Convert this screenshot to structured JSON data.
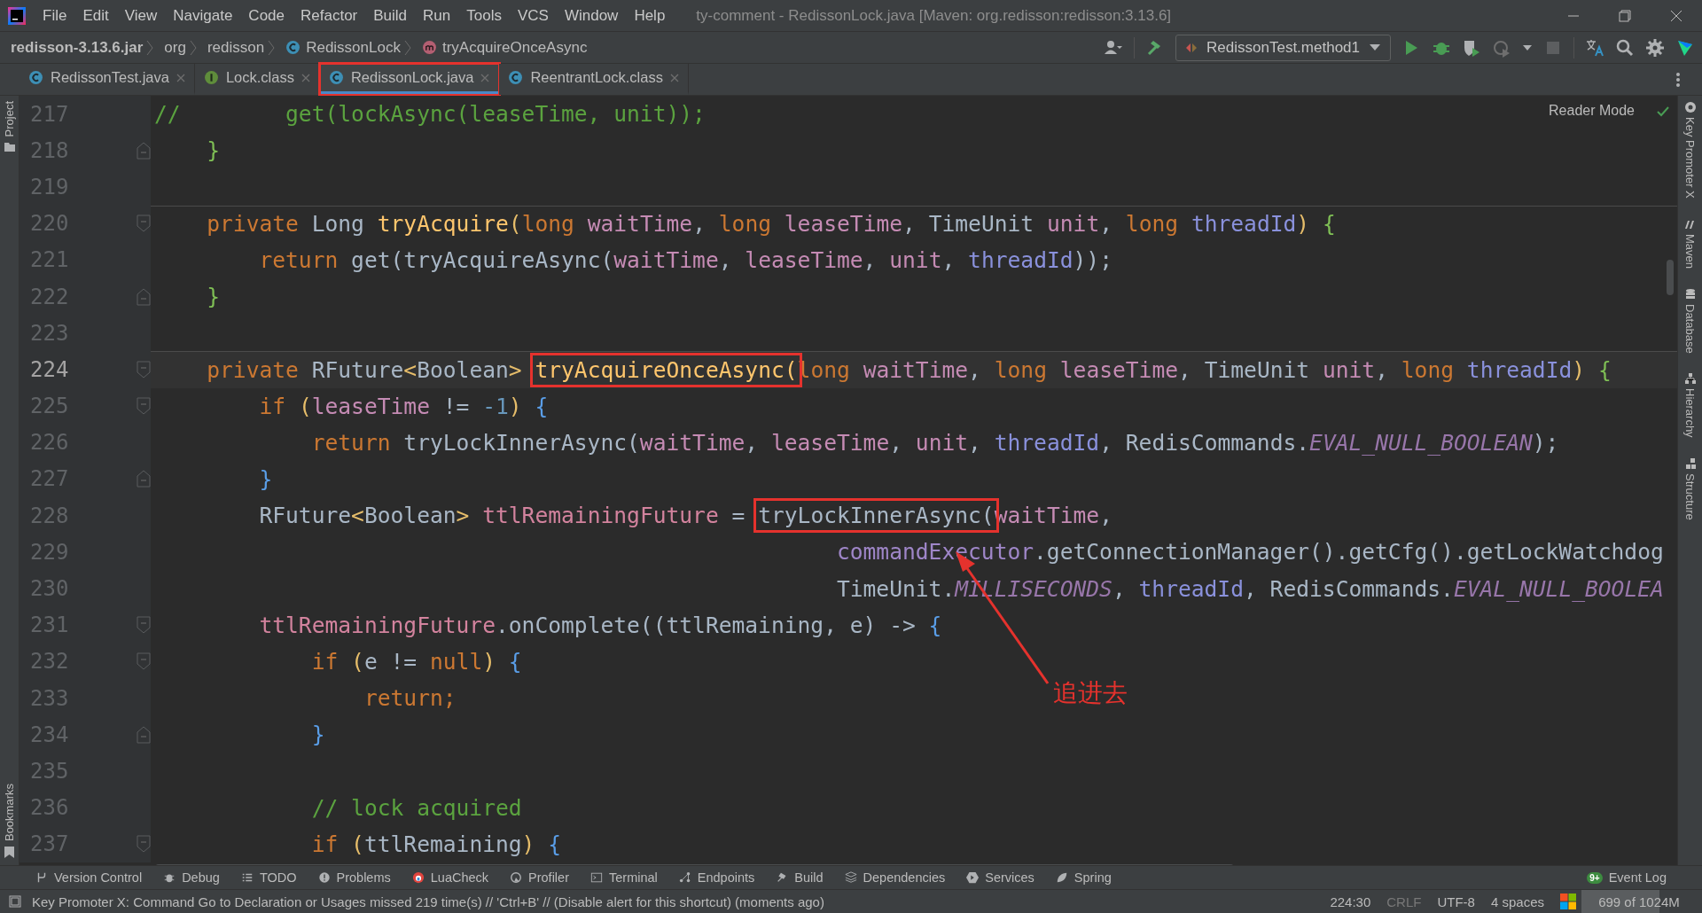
{
  "window": {
    "title": "ty-comment - RedissonLock.java [Maven: org.redisson:redisson:3.13.6]"
  },
  "menu": [
    "File",
    "Edit",
    "View",
    "Navigate",
    "Code",
    "Refactor",
    "Build",
    "Run",
    "Tools",
    "VCS",
    "Window",
    "Help"
  ],
  "breadcrumbs": [
    {
      "text": "redisson-3.13.6.jar",
      "kind": "jar"
    },
    {
      "text": "org",
      "kind": "package"
    },
    {
      "text": "redisson",
      "kind": "package"
    },
    {
      "text": "RedissonLock",
      "kind": "class"
    },
    {
      "text": "tryAcquireOnceAsync",
      "kind": "method"
    }
  ],
  "run_config": "RedissonTest.method1",
  "tabs": [
    {
      "label": "RedissonTest.java",
      "kind": "class",
      "selected": false,
      "highlighted": false
    },
    {
      "label": "Lock.class",
      "kind": "interface",
      "selected": false,
      "highlighted": false
    },
    {
      "label": "RedissonLock.java",
      "kind": "class",
      "selected": true,
      "highlighted": true
    },
    {
      "label": "ReentrantLock.class",
      "kind": "class",
      "selected": false,
      "highlighted": false
    }
  ],
  "reader_mode": "Reader Mode",
  "left_stripe": [
    "Project",
    "Bookmarks"
  ],
  "right_stripe": [
    "Key Promoter X",
    "Maven",
    "Database",
    "Hierarchy",
    "Structure"
  ],
  "lines": [
    {
      "number": "217",
      "current": false,
      "separator": false,
      "fold_open": false,
      "fold_close": false,
      "tokens": [
        {
          "text": "//        get(lockAsync(leaseTime, unit));",
          "kind": "comment"
        }
      ]
    },
    {
      "number": "218",
      "current": false,
      "separator": false,
      "fold_open": false,
      "fold_close": true,
      "tokens": [
        {
          "text": "    }",
          "kind": "br2"
        }
      ]
    },
    {
      "number": "219",
      "current": false,
      "separator": false,
      "fold_open": false,
      "fold_close": false
    },
    {
      "number": "220",
      "current": false,
      "separator": true,
      "fold_open": true,
      "fold_close": false,
      "tokens": [
        {
          "text": "    private ",
          "kind": "kw"
        },
        {
          "text": "Long ",
          "kind": "plain"
        },
        {
          "text": "tryAcquire",
          "kind": "method"
        },
        {
          "text": "(",
          "kind": "br1"
        },
        {
          "text": "long ",
          "kind": "kw"
        },
        {
          "text": "waitTime",
          "kind": "param"
        },
        {
          "text": ", ",
          "kind": "plain"
        },
        {
          "text": "long ",
          "kind": "kw"
        },
        {
          "text": "leaseTime",
          "kind": "param"
        },
        {
          "text": ", ",
          "kind": "plain"
        },
        {
          "text": "TimeUnit ",
          "kind": "plain"
        },
        {
          "text": "unit",
          "kind": "param"
        },
        {
          "text": ", ",
          "kind": "plain"
        },
        {
          "text": "long ",
          "kind": "kw"
        },
        {
          "text": "threadId",
          "kind": "param2"
        },
        {
          "text": ")",
          "kind": "br1"
        },
        {
          "text": " {",
          "kind": "br2"
        }
      ]
    },
    {
      "number": "221",
      "current": false,
      "separator": false,
      "fold_open": false,
      "fold_close": false,
      "tokens": [
        {
          "text": "        return ",
          "kind": "kw"
        },
        {
          "text": "get(tryAcquireAsync(",
          "kind": "plain"
        },
        {
          "text": "waitTime",
          "kind": "param"
        },
        {
          "text": ", ",
          "kind": "plain"
        },
        {
          "text": "leaseTime",
          "kind": "param"
        },
        {
          "text": ", ",
          "kind": "plain"
        },
        {
          "text": "unit",
          "kind": "param"
        },
        {
          "text": ", ",
          "kind": "plain"
        },
        {
          "text": "threadId",
          "kind": "param2"
        },
        {
          "text": "));",
          "kind": "plain"
        }
      ]
    },
    {
      "number": "222",
      "current": false,
      "separator": false,
      "fold_open": false,
      "fold_close": true,
      "tokens": [
        {
          "text": "    }",
          "kind": "br2"
        }
      ]
    },
    {
      "number": "223",
      "current": false,
      "separator": false,
      "fold_open": false,
      "fold_close": false
    },
    {
      "number": "224",
      "current": true,
      "separator": true,
      "fold_open": true,
      "fold_close": false,
      "tokens": [
        {
          "text": "    private ",
          "kind": "kw"
        },
        {
          "text": "RFuture",
          "kind": "plain"
        },
        {
          "text": "<",
          "kind": "br1"
        },
        {
          "text": "Boolean",
          "kind": "plain"
        },
        {
          "text": "> ",
          "kind": "br1"
        },
        {
          "text": "tryAcquireOnceAsync(",
          "kind": "method",
          "highlighted": true
        },
        {
          "text": "long ",
          "kind": "kw"
        },
        {
          "text": "waitTime",
          "kind": "param"
        },
        {
          "text": ", ",
          "kind": "plain"
        },
        {
          "text": "long ",
          "kind": "kw"
        },
        {
          "text": "leaseTime",
          "kind": "param"
        },
        {
          "text": ", ",
          "kind": "plain"
        },
        {
          "text": "TimeUnit ",
          "kind": "plain"
        },
        {
          "text": "unit",
          "kind": "param"
        },
        {
          "text": ", ",
          "kind": "plain"
        },
        {
          "text": "long ",
          "kind": "kw"
        },
        {
          "text": "threadId",
          "kind": "param2"
        },
        {
          "text": ")",
          "kind": "br1"
        },
        {
          "text": " {",
          "kind": "br2"
        }
      ]
    },
    {
      "number": "225",
      "current": false,
      "separator": false,
      "fold_open": true,
      "fold_close": false,
      "tokens": [
        {
          "text": "        if ",
          "kind": "kw"
        },
        {
          "text": "(",
          "kind": "br1"
        },
        {
          "text": "leaseTime",
          "kind": "param"
        },
        {
          "text": " != ",
          "kind": "plain"
        },
        {
          "text": "-1",
          "kind": "num"
        },
        {
          "text": ")",
          "kind": "br1"
        },
        {
          "text": " {",
          "kind": "br3"
        }
      ]
    },
    {
      "number": "226",
      "current": false,
      "separator": false,
      "fold_open": false,
      "fold_close": false,
      "tokens": [
        {
          "text": "            return ",
          "kind": "kw"
        },
        {
          "text": "tryLockInnerAsync(",
          "kind": "plain"
        },
        {
          "text": "waitTime",
          "kind": "param"
        },
        {
          "text": ", ",
          "kind": "plain"
        },
        {
          "text": "leaseTime",
          "kind": "param"
        },
        {
          "text": ", ",
          "kind": "plain"
        },
        {
          "text": "unit",
          "kind": "param"
        },
        {
          "text": ", ",
          "kind": "plain"
        },
        {
          "text": "threadId",
          "kind": "param2"
        },
        {
          "text": ", RedisCommands.",
          "kind": "plain"
        },
        {
          "text": "EVAL_NULL_BOOLEAN",
          "kind": "static"
        },
        {
          "text": ");",
          "kind": "plain"
        }
      ]
    },
    {
      "number": "227",
      "current": false,
      "separator": false,
      "fold_open": false,
      "fold_close": true,
      "tokens": [
        {
          "text": "        }",
          "kind": "br3"
        }
      ]
    },
    {
      "number": "228",
      "current": false,
      "separator": false,
      "fold_open": false,
      "fold_close": false,
      "tokens": [
        {
          "text": "        RFuture",
          "kind": "plain"
        },
        {
          "text": "<",
          "kind": "br1"
        },
        {
          "text": "Boolean",
          "kind": "plain"
        },
        {
          "text": "> ",
          "kind": "br1"
        },
        {
          "text": "ttlRemainingFuture",
          "kind": "local"
        },
        {
          "text": " = ",
          "kind": "plain"
        },
        {
          "text": "tryLockInnerAsync(",
          "kind": "plain",
          "highlighted": true
        },
        {
          "text": "waitTime",
          "kind": "param"
        },
        {
          "text": ",",
          "kind": "plain"
        }
      ]
    },
    {
      "number": "229",
      "current": false,
      "separator": false,
      "fold_open": false,
      "fold_close": false,
      "tokens": [
        {
          "text": "                                                    commandExecutor",
          "kind": "field"
        },
        {
          "text": ".getConnectionManager().getCfg().getLockWatchdog",
          "kind": "plain"
        }
      ]
    },
    {
      "number": "230",
      "current": false,
      "separator": false,
      "fold_open": false,
      "fold_close": false,
      "tokens": [
        {
          "text": "                                                    TimeUnit.",
          "kind": "plain"
        },
        {
          "text": "MILLISECONDS",
          "kind": "static"
        },
        {
          "text": ", ",
          "kind": "plain"
        },
        {
          "text": "threadId",
          "kind": "param2"
        },
        {
          "text": ", RedisCommands.",
          "kind": "plain"
        },
        {
          "text": "EVAL_NULL_BOOLEA",
          "kind": "static"
        }
      ]
    },
    {
      "number": "231",
      "current": false,
      "separator": false,
      "fold_open": true,
      "fold_close": false,
      "tokens": [
        {
          "text": "        ttlRemainingFuture",
          "kind": "local"
        },
        {
          "text": ".onComplete((ttlRemaining, e) -> ",
          "kind": "plain"
        },
        {
          "text": "{",
          "kind": "br3"
        }
      ]
    },
    {
      "number": "232",
      "current": false,
      "separator": false,
      "fold_open": true,
      "fold_close": false,
      "tokens": [
        {
          "text": "            if ",
          "kind": "kw"
        },
        {
          "text": "(",
          "kind": "br1"
        },
        {
          "text": "e != ",
          "kind": "plain"
        },
        {
          "text": "null",
          "kind": "kw"
        },
        {
          "text": ")",
          "kind": "br1"
        },
        {
          "text": " {",
          "kind": "br3"
        }
      ]
    },
    {
      "number": "233",
      "current": false,
      "separator": false,
      "fold_open": false,
      "fold_close": false,
      "tokens": [
        {
          "text": "                return;",
          "kind": "kw"
        }
      ]
    },
    {
      "number": "234",
      "current": false,
      "separator": false,
      "fold_open": false,
      "fold_close": true,
      "tokens": [
        {
          "text": "            }",
          "kind": "br3"
        }
      ]
    },
    {
      "number": "235",
      "current": false,
      "separator": false,
      "fold_open": false,
      "fold_close": false
    },
    {
      "number": "236",
      "current": false,
      "separator": false,
      "fold_open": false,
      "fold_close": false,
      "tokens": [
        {
          "text": "            // lock acquired",
          "kind": "comment"
        }
      ]
    },
    {
      "number": "237",
      "current": false,
      "separator": false,
      "fold_open": true,
      "fold_close": false,
      "tokens": [
        {
          "text": "            if ",
          "kind": "kw"
        },
        {
          "text": "(",
          "kind": "br1"
        },
        {
          "text": "ttlRemaining",
          "kind": "plain"
        },
        {
          "text": ")",
          "kind": "br1"
        },
        {
          "text": " {",
          "kind": "br3"
        }
      ]
    }
  ],
  "annotation": {
    "text": "追进去"
  },
  "tool_windows": [
    "Version Control",
    "Debug",
    "TODO",
    "Problems",
    "LuaCheck",
    "Profiler",
    "Terminal",
    "Endpoints",
    "Build",
    "Dependencies",
    "Services",
    "Spring"
  ],
  "event_log": {
    "badge": "9+",
    "label": "Event Log"
  },
  "status_bar": {
    "message": "Key Promoter X: Command Go to Declaration or Usages missed 219 time(s) // 'Ctrl+B' // (Disable alert for this shortcut) (moments ago)",
    "position": "224:30",
    "line_separator": "CRLF",
    "encoding": "UTF-8",
    "indent": "4 spaces",
    "memory": {
      "text": "699 of 1024M",
      "level": 0.68
    }
  }
}
